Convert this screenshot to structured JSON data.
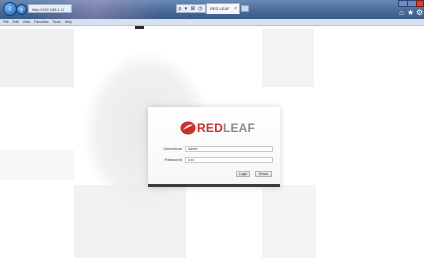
{
  "browser": {
    "address_text": "http://192.168.1.1/",
    "address_controls": "ρ ▾ ⊠ ◷ ×",
    "tab_label": "RED LEAF",
    "tab_close": "×",
    "menu_items": [
      "File",
      "Edit",
      "View",
      "Favorites",
      "Tools",
      "Help"
    ]
  },
  "login": {
    "brand_red": "RED",
    "brand_grey": "LEAF",
    "username_label": "Username",
    "username_value": "admin",
    "password_label": "Password",
    "password_value": "•••••",
    "login_button": "Login",
    "reset_button": "Reset"
  },
  "colors": {
    "brand_red": "#c9302c",
    "brand_grey": "#8d8d8d",
    "chrome_blue": "#4c6a98"
  }
}
